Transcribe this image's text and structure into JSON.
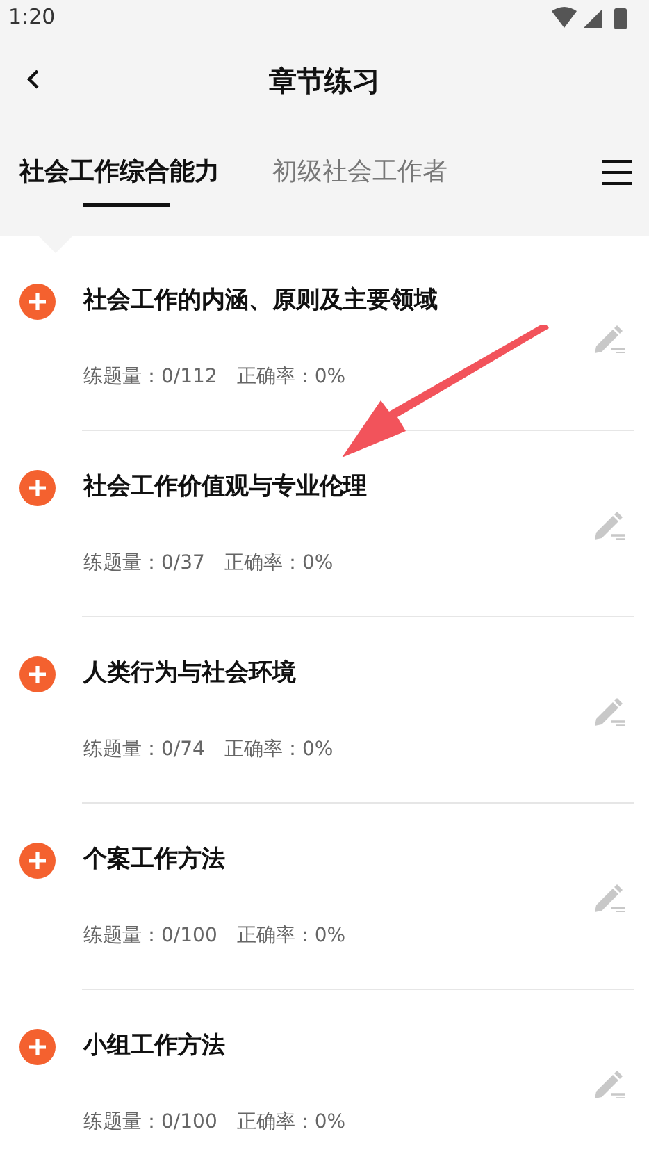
{
  "status_bar": {
    "time": "1:20"
  },
  "header": {
    "title": "章节练习"
  },
  "tabs": [
    {
      "label": "社会工作综合能力",
      "selected": true
    },
    {
      "label": "初级社会工作者",
      "selected": false
    }
  ],
  "chapters": [
    {
      "title": "社会工作的内涵、原则及主要领域",
      "count_label": "练题量：",
      "count": "0/112",
      "accuracy_label": "正确率：",
      "accuracy": "0%"
    },
    {
      "title": "社会工作价值观与专业伦理",
      "count_label": "练题量：",
      "count": "0/37",
      "accuracy_label": "正确率：",
      "accuracy": "0%"
    },
    {
      "title": "人类行为与社会环境",
      "count_label": "练题量：",
      "count": "0/74",
      "accuracy_label": "正确率：",
      "accuracy": "0%"
    },
    {
      "title": "个案工作方法",
      "count_label": "练题量：",
      "count": "0/100",
      "accuracy_label": "正确率：",
      "accuracy": "0%"
    },
    {
      "title": "小组工作方法",
      "count_label": "练题量：",
      "count": "0/100",
      "accuracy_label": "正确率：",
      "accuracy": "0%"
    }
  ]
}
